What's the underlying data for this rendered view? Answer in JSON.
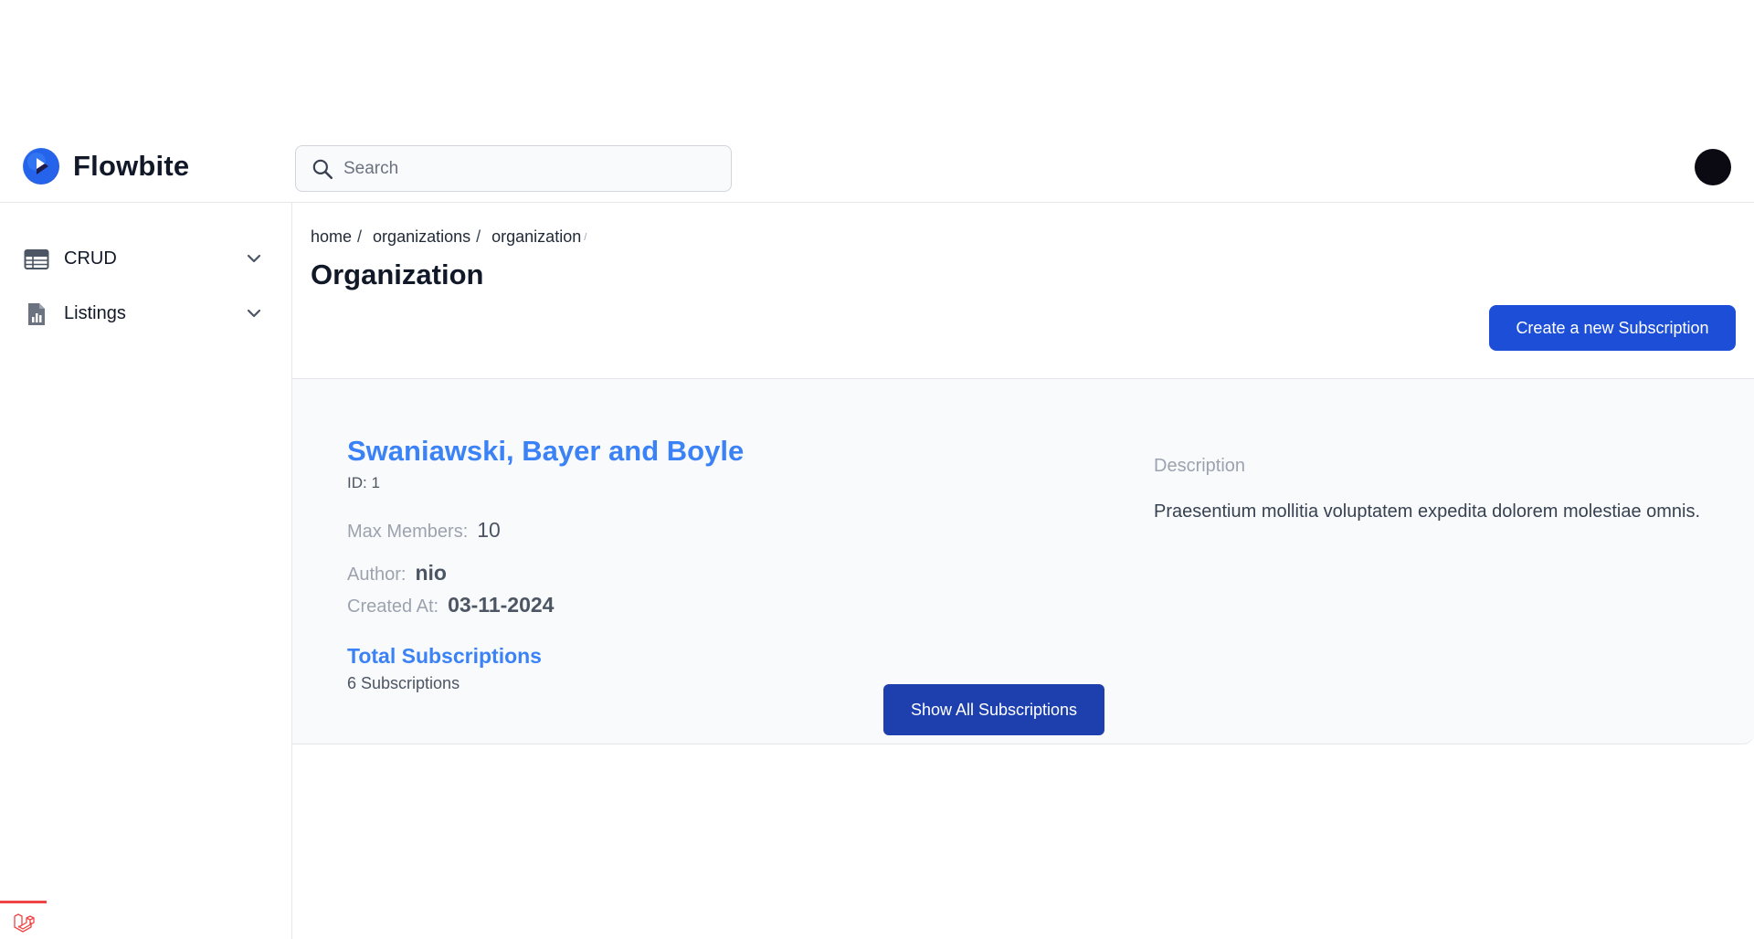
{
  "app": {
    "name": "Flowbite",
    "brand_color": "#1d4ed8"
  },
  "search": {
    "placeholder": "Search",
    "value": ""
  },
  "sidebar": {
    "items": [
      {
        "label": "CRUD",
        "icon": "table-icon"
      },
      {
        "label": "Listings",
        "icon": "document-chart-icon"
      }
    ]
  },
  "breadcrumb": {
    "items": [
      "home",
      "organizations",
      "organization"
    ],
    "separator": "/"
  },
  "page": {
    "title": "Organization"
  },
  "actions": {
    "create_label": "Create a new Subscription"
  },
  "organization": {
    "name": "Swaniawski, Bayer and Boyle",
    "id_text": "ID: 1",
    "max_members_label": "Max Members:",
    "max_members_value": "10",
    "author_label": "Author:",
    "author_value": "nio",
    "created_label": "Created At:",
    "created_value": "03-11-2024",
    "total_title": "Total Subscriptions",
    "total_count": "6 Subscriptions",
    "show_all_label": "Show All Subscriptions",
    "description_label": "Description",
    "description_text": "Praesentium mollitia voluptatem expedita dolorem molestiae omnis."
  },
  "colors": {
    "accent": "#3b82f6",
    "button_primary": "#1d4ed8",
    "button_dark": "#1e40af",
    "card_bg": "#f9fafb"
  }
}
